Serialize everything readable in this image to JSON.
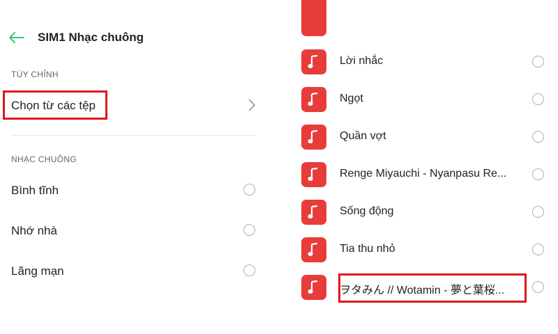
{
  "left": {
    "title": "SIM1 Nhạc chuông",
    "custom_section": "TÙY CHỈNH",
    "pick_file": "Chọn từ các tệp",
    "ringtone_section": "NHẠC CHUÔNG",
    "options": [
      "Bình tĩnh",
      "Nhớ nhà",
      "Lãng mạn"
    ]
  },
  "right": {
    "items": [
      "Lời nhắc",
      "Ngọt",
      "Quần vợt",
      "Renge Miyauchi - Nyanpasu Re...",
      "Sống động",
      "Tia thu nhỏ",
      "ヲタみん // Wotamin - 夢と葉桜..."
    ]
  },
  "colors": {
    "accent_green": "#3cc47c",
    "icon_red": "#e83c3b",
    "highlight_red": "#e0161d"
  },
  "icons": {
    "back": "arrow-left-icon",
    "next": "chevron-right-icon",
    "song": "music-note-icon"
  }
}
